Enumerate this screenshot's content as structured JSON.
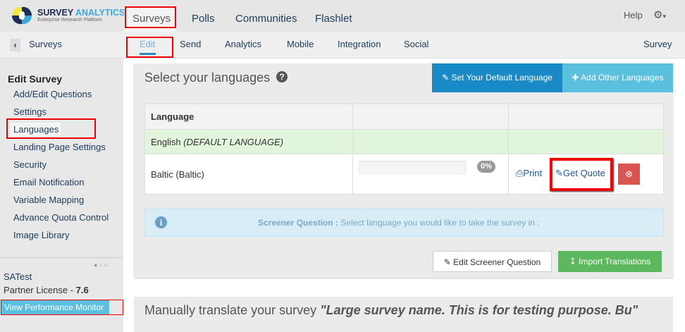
{
  "brand": {
    "name1": "SURVEY",
    "name2": "ANALYTICS",
    "tagline": "Enterprise Research Platform"
  },
  "topnav": [
    "Surveys",
    "Polls",
    "Communities",
    "Flashlet"
  ],
  "help": "Help",
  "subnav": {
    "back": "Surveys",
    "items": [
      "Edit",
      "Send",
      "Analytics",
      "Mobile",
      "Integration",
      "Social"
    ],
    "right": "Survey"
  },
  "sidebar": {
    "title": "Edit Survey",
    "items": [
      "Add/Edit Questions",
      "Settings",
      "Languages",
      "Landing Page Settings",
      "Security",
      "Email Notification",
      "Variable Mapping",
      "Advance Quota Control",
      "Image Library"
    ],
    "user": "SATest",
    "license": "Partner License - ",
    "version": "7.6",
    "monitor": "View Performance Monitor"
  },
  "panel": {
    "title": "Select your languages",
    "default_btn": "Set Your Default Language",
    "add_btn": "Add Other Languages",
    "col_language": "Language",
    "rows": [
      {
        "name": "English",
        "note": "(DEFAULT LANGUAGE)"
      },
      {
        "name": "Baltic (Baltic)",
        "progress": "0%",
        "print": "Print",
        "quote": "Get Quote"
      }
    ],
    "screener_label": "Screener Question :",
    "screener_text": "Select language you would like to take the survey in :",
    "edit_screener": "Edit Screener Question",
    "import": "Import Translations"
  },
  "manual": {
    "prefix": "Manually translate your survey ",
    "name": "\"Large survey name. This is for testing purpose. Bu\""
  },
  "colors": {
    "accent": "#1a8ac6",
    "light_accent": "#5bc0de",
    "success": "#5cb85c",
    "danger": "#d9534f"
  }
}
